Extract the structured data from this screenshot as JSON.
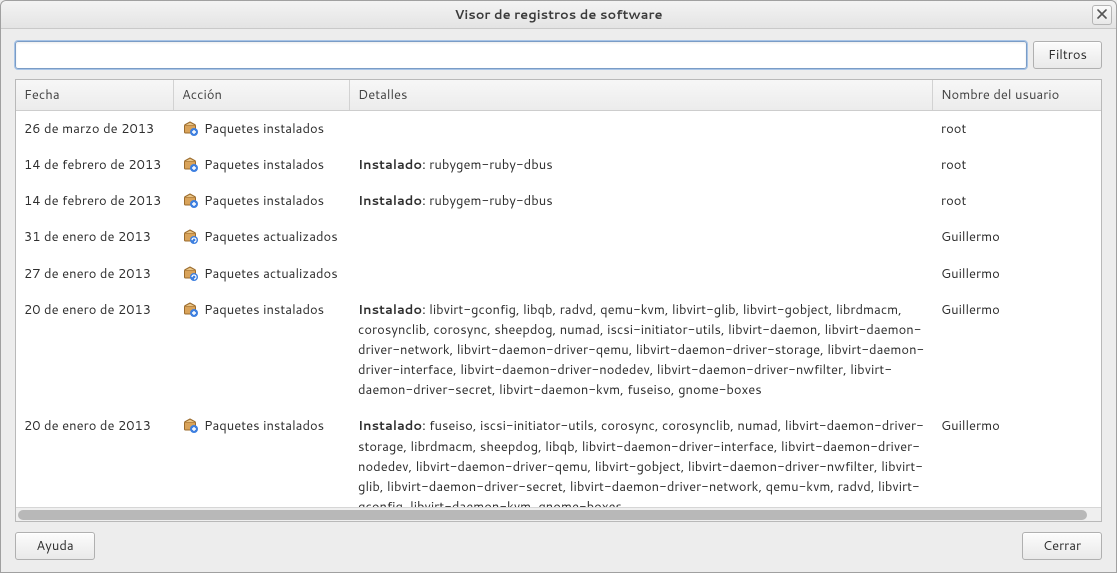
{
  "window": {
    "title": "Visor de registros de software"
  },
  "search": {
    "placeholder": "",
    "value": "",
    "filter_button": "Filtros"
  },
  "columns": {
    "date": "Fecha",
    "action": "Acción",
    "details": "Detalles",
    "user": "Nombre del usuario"
  },
  "action_labels": {
    "installed": "Paquetes instalados",
    "updated": "Paquetes actualizados"
  },
  "detail_prefix": {
    "installed": "Instalado"
  },
  "rows": [
    {
      "date": "26 de marzo de 2013",
      "action_type": "installed",
      "detail_prefix": "",
      "detail": "",
      "user": "root"
    },
    {
      "date": "14 de febrero de 2013",
      "action_type": "installed",
      "detail_prefix": "installed",
      "detail": "rubygem-ruby-dbus",
      "user": "root"
    },
    {
      "date": "14 de febrero de 2013",
      "action_type": "installed",
      "detail_prefix": "installed",
      "detail": "rubygem-ruby-dbus",
      "user": "root"
    },
    {
      "date": "31 de enero de 2013",
      "action_type": "updated",
      "detail_prefix": "",
      "detail": "",
      "user": "Guillermo"
    },
    {
      "date": "27 de enero de 2013",
      "action_type": "updated",
      "detail_prefix": "",
      "detail": "",
      "user": "Guillermo"
    },
    {
      "date": "20 de enero de 2013",
      "action_type": "installed",
      "detail_prefix": "installed",
      "detail": "libvirt-gconfig, libqb, radvd, qemu-kvm, libvirt-glib, libvirt-gobject, librdmacm, corosynclib, corosync, sheepdog, numad, iscsi-initiator-utils, libvirt-daemon, libvirt-daemon-driver-network, libvirt-daemon-driver-qemu, libvirt-daemon-driver-storage, libvirt-daemon-driver-interface, libvirt-daemon-driver-nodedev, libvirt-daemon-driver-nwfilter, libvirt-daemon-driver-secret, libvirt-daemon-kvm, fuseiso, gnome-boxes",
      "user": "Guillermo"
    },
    {
      "date": "20 de enero de 2013",
      "action_type": "installed",
      "detail_prefix": "installed",
      "detail": "fuseiso, iscsi-initiator-utils, corosync, corosynclib, numad, libvirt-daemon-driver-storage, librdmacm, sheepdog, libqb, libvirt-daemon-driver-interface, libvirt-daemon-driver-nodedev, libvirt-daemon-driver-qemu, libvirt-gobject, libvirt-daemon-driver-nwfilter, libvirt-glib, libvirt-daemon-driver-secret, libvirt-daemon-driver-network, qemu-kvm, radvd, libvirt-gconfig, libvirt-daemon-kvm, gnome-boxes,",
      "user": "Guillermo"
    }
  ],
  "footer": {
    "help": "Ayuda",
    "close": "Cerrar"
  },
  "icons": {
    "install": "package-install-icon",
    "update": "package-update-icon"
  }
}
